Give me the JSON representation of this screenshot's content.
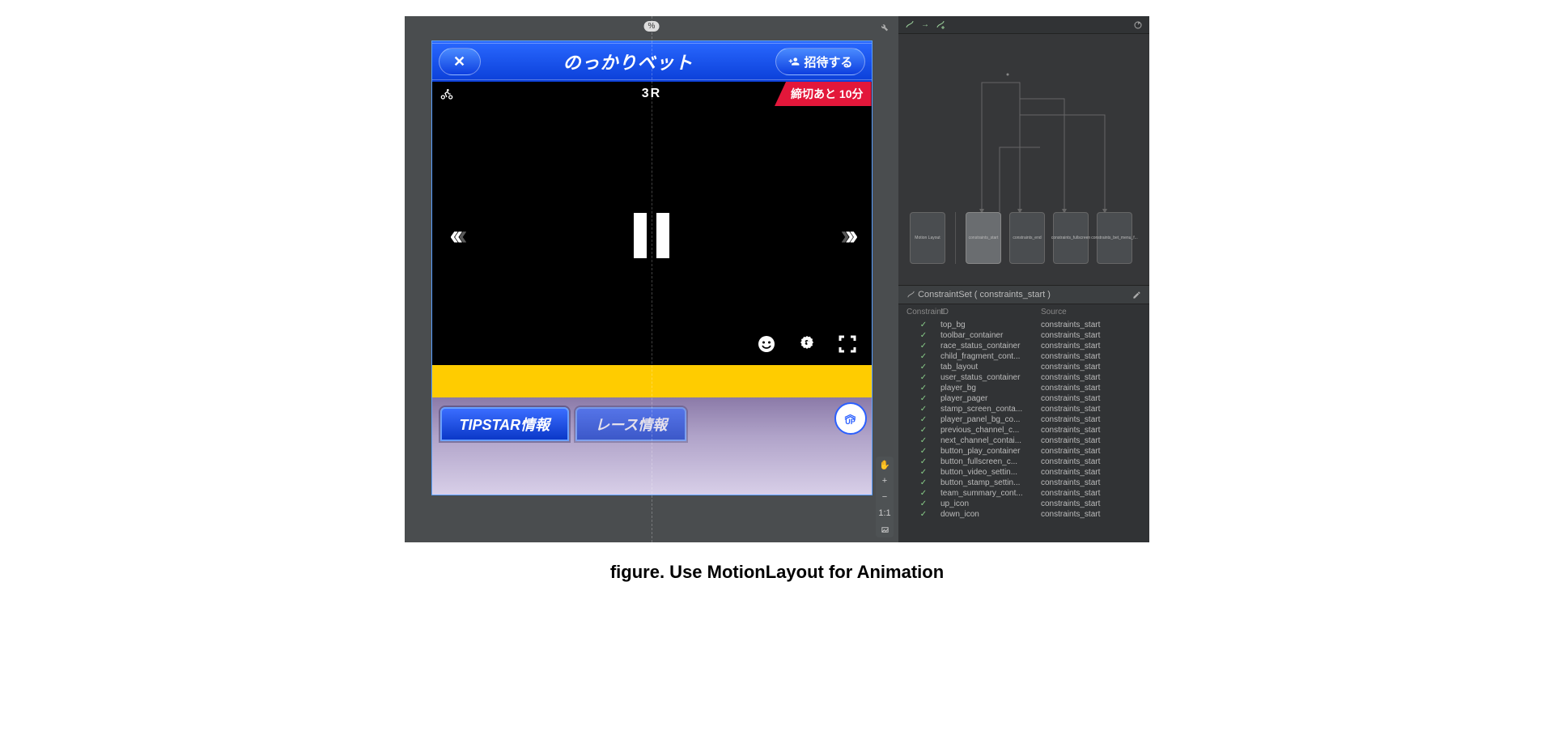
{
  "ruler_badge": "%",
  "wrench_icon": "wrench",
  "device": {
    "title": "のっかりベット",
    "close_label": "✕",
    "invite_label": "招待する",
    "race_number": "3R",
    "deadline": "締切あと 10分",
    "tabs": [
      "TIPSTAR情報",
      "レース情報"
    ],
    "up_label": "UP"
  },
  "zoom": {
    "hand": "✋",
    "plus": "+",
    "minus": "−",
    "ratio": "1:1"
  },
  "motion": {
    "nodes": [
      "Motion Layout",
      "constraints_start",
      "constraints_end",
      "constraints_fullscreen",
      "constraints_bet_menu_f..."
    ],
    "constraintset_label": "ConstraintSet (",
    "constraintset_name": "constraints_start",
    "constraintset_suffix": ")",
    "cols": [
      "Constraint",
      "ID",
      "Source"
    ],
    "rows": [
      {
        "id": "top_bg",
        "src": "constraints_start"
      },
      {
        "id": "toolbar_container",
        "src": "constraints_start"
      },
      {
        "id": "race_status_container",
        "src": "constraints_start"
      },
      {
        "id": "child_fragment_cont...",
        "src": "constraints_start"
      },
      {
        "id": "tab_layout",
        "src": "constraints_start"
      },
      {
        "id": "user_status_container",
        "src": "constraints_start"
      },
      {
        "id": "player_bg",
        "src": "constraints_start"
      },
      {
        "id": "player_pager",
        "src": "constraints_start"
      },
      {
        "id": "stamp_screen_conta...",
        "src": "constraints_start"
      },
      {
        "id": "player_panel_bg_co...",
        "src": "constraints_start"
      },
      {
        "id": "previous_channel_c...",
        "src": "constraints_start"
      },
      {
        "id": "next_channel_contai...",
        "src": "constraints_start"
      },
      {
        "id": "button_play_container",
        "src": "constraints_start"
      },
      {
        "id": "button_fullscreen_c...",
        "src": "constraints_start"
      },
      {
        "id": "button_video_settin...",
        "src": "constraints_start"
      },
      {
        "id": "button_stamp_settin...",
        "src": "constraints_start"
      },
      {
        "id": "team_summary_cont...",
        "src": "constraints_start"
      },
      {
        "id": "up_icon",
        "src": "constraints_start"
      },
      {
        "id": "down_icon",
        "src": "constraints_start"
      }
    ]
  },
  "caption": "figure. Use MotionLayout for Animation"
}
